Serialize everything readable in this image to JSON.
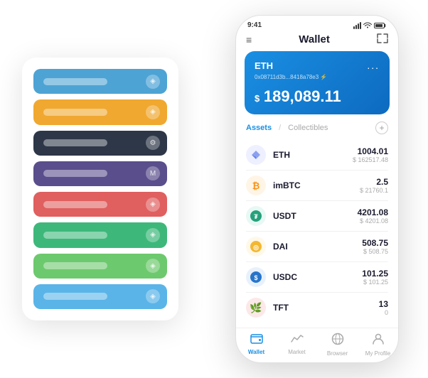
{
  "scene": {
    "bg_card": {
      "rows": [
        {
          "color": "row-blue",
          "icon": "◈"
        },
        {
          "color": "row-orange",
          "icon": "◈"
        },
        {
          "color": "row-dark",
          "icon": "⚙"
        },
        {
          "color": "row-purple",
          "icon": "M"
        },
        {
          "color": "row-red",
          "icon": "◈"
        },
        {
          "color": "row-green",
          "icon": "◈"
        },
        {
          "color": "row-light-green",
          "icon": "◈"
        },
        {
          "color": "row-light-blue",
          "icon": "◈"
        }
      ]
    },
    "phone": {
      "status_bar": {
        "time": "9:41",
        "signal": "▌▌▌",
        "wifi": "wifi",
        "battery": "battery"
      },
      "header": {
        "menu_icon": "≡",
        "title": "Wallet",
        "expand_icon": "⇔"
      },
      "eth_card": {
        "label": "ETH",
        "dots": "...",
        "address": "0x08711d3b...8418a78e3  ⚡",
        "currency_symbol": "$ ",
        "balance": "189,089.11"
      },
      "assets_section": {
        "tab_active": "Assets",
        "divider": "/",
        "tab_inactive": "Collectibles",
        "add_icon": "+"
      },
      "asset_list": [
        {
          "name": "ETH",
          "amount": "1004.01",
          "usd": "$ 162517.48",
          "icon_color": "#627eea",
          "icon_text": "♦",
          "icon_bg": "#eef0ff"
        },
        {
          "name": "imBTC",
          "amount": "2.5",
          "usd": "$ 21760.1",
          "icon_color": "#f7931a",
          "icon_text": "₿",
          "icon_bg": "#fff5e6"
        },
        {
          "name": "USDT",
          "amount": "4201.08",
          "usd": "$ 4201.08",
          "icon_color": "#26a17b",
          "icon_text": "₮",
          "icon_bg": "#e8f8f4"
        },
        {
          "name": "DAI",
          "amount": "508.75",
          "usd": "$ 508.75",
          "icon_color": "#f4b731",
          "icon_text": "◎",
          "icon_bg": "#fdf8e8"
        },
        {
          "name": "USDC",
          "amount": "101.25",
          "usd": "$ 101.25",
          "icon_color": "#2775ca",
          "icon_text": "◎",
          "icon_bg": "#e8f1fb"
        },
        {
          "name": "TFT",
          "amount": "13",
          "usd": "0",
          "icon_color": "#e8554e",
          "icon_text": "🌿",
          "icon_bg": "#fce8e8"
        }
      ],
      "bottom_nav": [
        {
          "label": "Wallet",
          "icon": "◎",
          "active": true
        },
        {
          "label": "Market",
          "icon": "📈",
          "active": false
        },
        {
          "label": "Browser",
          "icon": "⊕",
          "active": false
        },
        {
          "label": "My Profile",
          "icon": "👤",
          "active": false
        }
      ]
    }
  }
}
